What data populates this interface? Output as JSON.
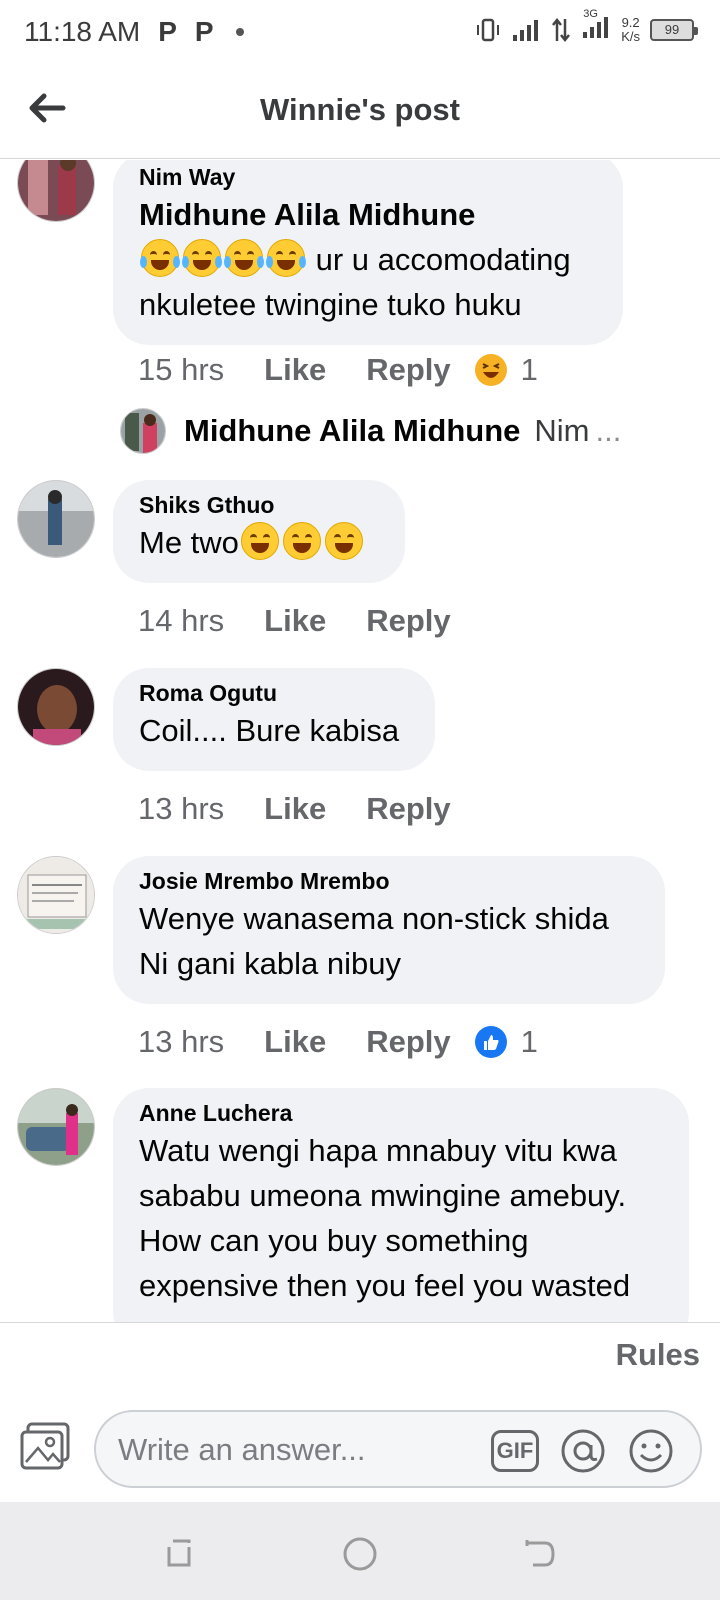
{
  "status": {
    "time": "11:18 AM",
    "notif1": "P",
    "notif2": "P",
    "network": "3G",
    "speed_value": "9.2",
    "speed_unit": "K/s",
    "battery": "99"
  },
  "header": {
    "title": "Winnie's post"
  },
  "comments": [
    {
      "author": "Nim Way",
      "mention": "Midhune Alila Midhune",
      "text": " ur u accomodating nkuletee twingine tuko huku",
      "time": "15 hrs",
      "like": "Like",
      "reply": "Reply",
      "reaction_count": "1",
      "reaction": "haha-icon"
    },
    {
      "author": "Shiks Gthuo",
      "text": "Me two",
      "time": "14 hrs",
      "like": "Like",
      "reply": "Reply"
    },
    {
      "author": "Roma Ogutu",
      "text": "Coil.... Bure kabisa",
      "time": "13 hrs",
      "like": "Like",
      "reply": "Reply"
    },
    {
      "author": "Josie Mrembo Mrembo",
      "text_line1": "Wenye wanasema non-stick shida",
      "text_line2": "Ni gani kabla nibuy",
      "time": "13 hrs",
      "like": "Like",
      "reply": "Reply",
      "reaction_count": "1",
      "reaction": "like-icon"
    },
    {
      "author": "Anne Luchera",
      "text_line1": "Watu wengi hapa mnabuy vitu kwa",
      "text_line2": "sababu umeona mwingine amebuy.",
      "text_line3": "How can you buy something",
      "text_line4": "expensive then you feel you wasted"
    }
  ],
  "reply_preview": {
    "name": "Midhune Alila Midhune",
    "text": "Nim",
    "more": "..."
  },
  "composer": {
    "rules": "Rules",
    "placeholder": "Write an answer...",
    "gif": "GIF"
  },
  "colors": {
    "bubble": "#f0f2f5",
    "meta": "#65676b",
    "like_blue": "#1877f2",
    "haha_yellow": "#f7b125"
  }
}
